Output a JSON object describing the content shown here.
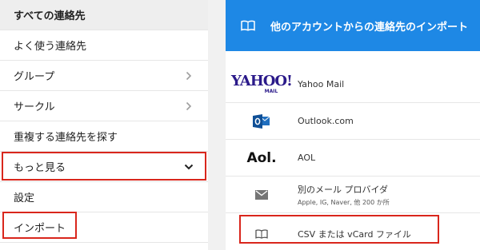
{
  "sidebar": {
    "header": "すべての連絡先",
    "items": [
      {
        "label": "よく使う連絡先",
        "icon": ""
      },
      {
        "label": "グループ",
        "icon": "chevron-right-icon"
      },
      {
        "label": "サークル",
        "icon": "chevron-right-icon"
      },
      {
        "label": "重複する連絡先を探す",
        "icon": ""
      },
      {
        "label": "もっと見る",
        "icon": "chevron-down-icon"
      },
      {
        "label": "設定",
        "icon": ""
      },
      {
        "label": "インポート",
        "icon": ""
      }
    ]
  },
  "dialog": {
    "title": "他のアカウントからの連絡先のインポート",
    "header_icon": "book-icon",
    "providers": [
      {
        "name": "Yahoo Mail",
        "logo": "YAHOO!",
        "logo_sub": "MAIL"
      },
      {
        "name": "Outlook.com",
        "logo": "outlook-icon"
      },
      {
        "name": "AOL",
        "logo": "Aol."
      },
      {
        "name": "別のメール プロバイダ",
        "sub": "Apple, IG, Naver, 他 200 か所",
        "logo": "mail-icon"
      },
      {
        "name": "CSV または vCard ファイル",
        "logo": "book-icon"
      }
    ]
  },
  "colors": {
    "header_blue": "#1e88e5",
    "highlight_red": "#d9261c",
    "sidebar_header_bg": "#eeeeee"
  }
}
